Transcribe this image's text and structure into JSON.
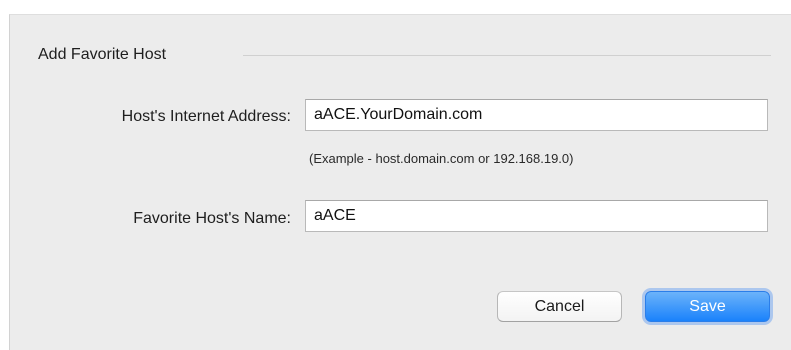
{
  "group": {
    "title": "Add Favorite Host"
  },
  "fields": {
    "address": {
      "label": "Host's Internet Address:",
      "value": "aACE.YourDomain.com",
      "hint": "(Example - host.domain.com or 192.168.19.0)"
    },
    "name": {
      "label": "Favorite Host's Name:",
      "value": "aACE"
    }
  },
  "buttons": {
    "cancel_label": "Cancel",
    "save_label": "Save"
  },
  "colors": {
    "dialog_background": "#ececec",
    "accent": "#1a82fb"
  }
}
